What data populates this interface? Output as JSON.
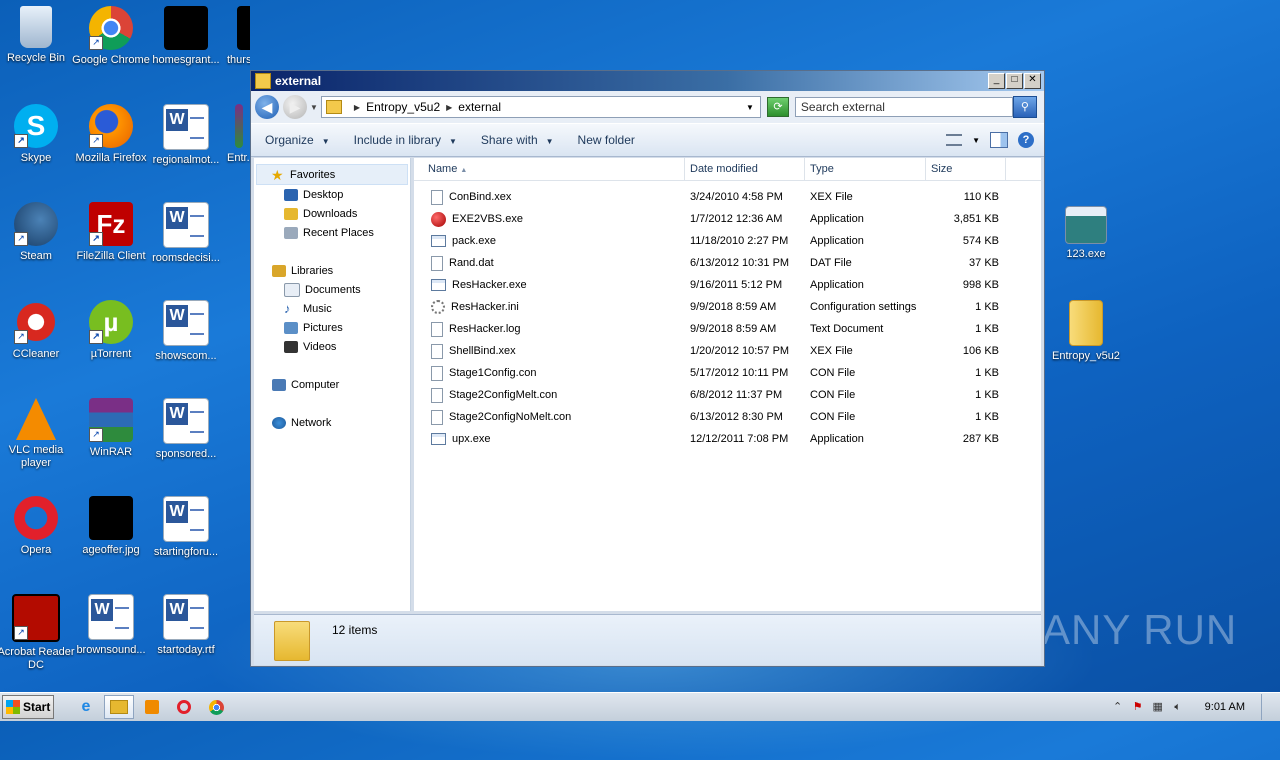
{
  "desktop": {
    "icons": [
      {
        "label": "Recycle Bin"
      },
      {
        "label": "Google Chrome"
      },
      {
        "label": "homesgrant..."
      },
      {
        "label": "thursdayba..."
      },
      {
        "label": "Skype"
      },
      {
        "label": "Mozilla Firefox"
      },
      {
        "label": "regionalmot..."
      },
      {
        "label": "Entr..."
      },
      {
        "label": "Steam"
      },
      {
        "label": "FileZilla Client"
      },
      {
        "label": "roomsdecisi..."
      },
      {
        "label": "CCleaner"
      },
      {
        "label": "µTorrent"
      },
      {
        "label": "showscom..."
      },
      {
        "label": "VLC media player"
      },
      {
        "label": "WinRAR"
      },
      {
        "label": "sponsored..."
      },
      {
        "label": "Opera"
      },
      {
        "label": "ageoffer.jpg"
      },
      {
        "label": "startingforu..."
      },
      {
        "label": "Acrobat Reader DC"
      },
      {
        "label": "brownsound..."
      },
      {
        "label": "startoday.rtf"
      },
      {
        "label": "123.exe"
      },
      {
        "label": "Entropy_v5u2"
      }
    ]
  },
  "window": {
    "title": "external",
    "buttons": {
      "minimize": "_",
      "maximize": "□",
      "close": "✕"
    },
    "address": {
      "crumb1": "Entropy_v5u2",
      "crumb2": "external"
    },
    "search_placeholder": "Search external",
    "toolbar": {
      "organize": "Organize",
      "include": "Include in library",
      "share": "Share with",
      "newfolder": "New folder"
    },
    "nav": {
      "favorites": "Favorites",
      "desktop": "Desktop",
      "downloads": "Downloads",
      "recent": "Recent Places",
      "libraries": "Libraries",
      "documents": "Documents",
      "music": "Music",
      "pictures": "Pictures",
      "videos": "Videos",
      "computer": "Computer",
      "network": "Network"
    },
    "columns": {
      "name": "Name",
      "date": "Date modified",
      "type": "Type",
      "size": "Size"
    },
    "files": [
      {
        "name": "ConBind.xex",
        "date": "3/24/2010 4:58 PM",
        "type": "XEX File",
        "size": "110 KB",
        "icon": "file"
      },
      {
        "name": "EXE2VBS.exe",
        "date": "1/7/2012 12:36 AM",
        "type": "Application",
        "size": "3,851 KB",
        "icon": "red"
      },
      {
        "name": "pack.exe",
        "date": "11/18/2010 2:27 PM",
        "type": "Application",
        "size": "574 KB",
        "icon": "app"
      },
      {
        "name": "Rand.dat",
        "date": "6/13/2012 10:31 PM",
        "type": "DAT File",
        "size": "37 KB",
        "icon": "file"
      },
      {
        "name": "ResHacker.exe",
        "date": "9/16/2011 5:12 PM",
        "type": "Application",
        "size": "998 KB",
        "icon": "app"
      },
      {
        "name": "ResHacker.ini",
        "date": "9/9/2018 8:59 AM",
        "type": "Configuration settings",
        "size": "1 KB",
        "icon": "cfg"
      },
      {
        "name": "ResHacker.log",
        "date": "9/9/2018 8:59 AM",
        "type": "Text Document",
        "size": "1 KB",
        "icon": "file"
      },
      {
        "name": "ShellBind.xex",
        "date": "1/20/2012 10:57 PM",
        "type": "XEX File",
        "size": "106 KB",
        "icon": "file"
      },
      {
        "name": "Stage1Config.con",
        "date": "5/17/2012 10:11 PM",
        "type": "CON File",
        "size": "1 KB",
        "icon": "file"
      },
      {
        "name": "Stage2ConfigMelt.con",
        "date": "6/8/2012 11:37 PM",
        "type": "CON File",
        "size": "1 KB",
        "icon": "file"
      },
      {
        "name": "Stage2ConfigNoMelt.con",
        "date": "6/13/2012 8:30 PM",
        "type": "CON File",
        "size": "1 KB",
        "icon": "file"
      },
      {
        "name": "upx.exe",
        "date": "12/12/2011 7:08 PM",
        "type": "Application",
        "size": "287 KB",
        "icon": "app"
      }
    ],
    "status": "12 items"
  },
  "taskbar": {
    "start": "Start",
    "time": "9:01 AM"
  },
  "watermark": "ANY RUN"
}
